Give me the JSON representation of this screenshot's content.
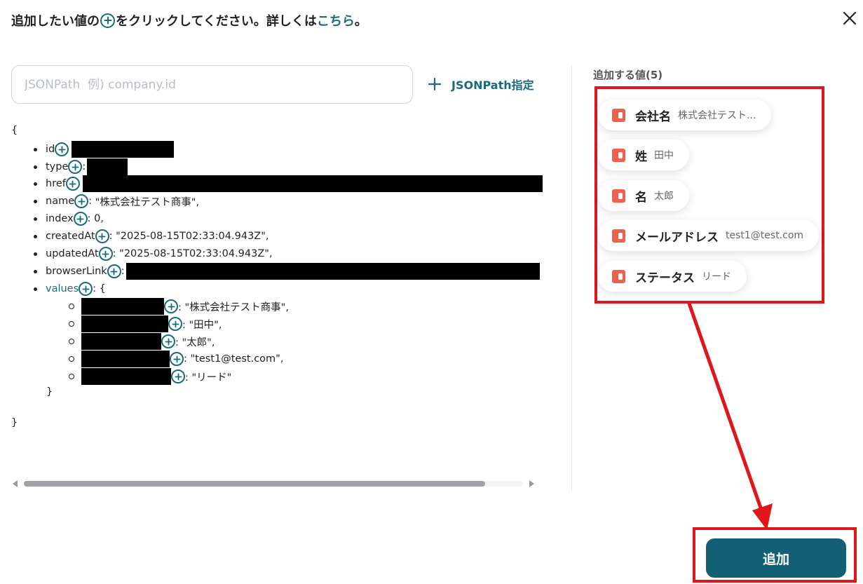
{
  "header": {
    "text_before": "追加したい値の",
    "text_after": "をクリックしてください。詳しくは",
    "link": "こちら",
    "end": "。"
  },
  "icons": {
    "add": "plus-circle-icon",
    "close": "close-icon",
    "chip": "app-logo-icon"
  },
  "jsonpath": {
    "placeholder": "JSONPath  例) company.id",
    "add_label": "JSONPath指定"
  },
  "tree": {
    "open": "{",
    "close": "}",
    "rows": [
      {
        "key": "id",
        "sep": "",
        "value": "",
        "redacted": true
      },
      {
        "key": "type",
        "sep": ":",
        "value": "",
        "redacted": true
      },
      {
        "key": "href",
        "sep": "",
        "value": "",
        "redacted": true
      },
      {
        "key": "name",
        "sep": ": ",
        "value": "\"株式会社テスト商事\","
      },
      {
        "key": "index",
        "sep": ": ",
        "value": "0,"
      },
      {
        "key": "createdAt",
        "sep": ": ",
        "value": "\"2025-08-15T02:33:04.943Z\","
      },
      {
        "key": "updatedAt",
        "sep": ": ",
        "value": "\"2025-08-15T02:33:04.943Z\","
      },
      {
        "key": "browserLink",
        "sep": ":",
        "value": "",
        "redacted": true
      },
      {
        "key": "values",
        "sep": ": ",
        "value": "{"
      }
    ],
    "children": [
      {
        "value": ": \"株式会社テスト商事\","
      },
      {
        "value": ": \"田中\","
      },
      {
        "value": ": \"太郎\","
      },
      {
        "value": ": \"test1@test.com\","
      },
      {
        "value": ": \"リード\""
      }
    ],
    "children_close": "}"
  },
  "panel": {
    "title": "追加する値(5)",
    "chips": [
      {
        "label": "会社名",
        "value": "株式会社テスト..."
      },
      {
        "label": "姓",
        "value": "田中"
      },
      {
        "label": "名",
        "value": "太郎"
      },
      {
        "label": "メールアドレス",
        "value": "test1@test.com"
      },
      {
        "label": "ステータス",
        "value": "リード"
      }
    ]
  },
  "submit_label": "追加",
  "colors": {
    "accent": "#1a6a80",
    "button": "#135f74",
    "highlight": "#e0161c",
    "chip_icon": "#f0604a"
  }
}
